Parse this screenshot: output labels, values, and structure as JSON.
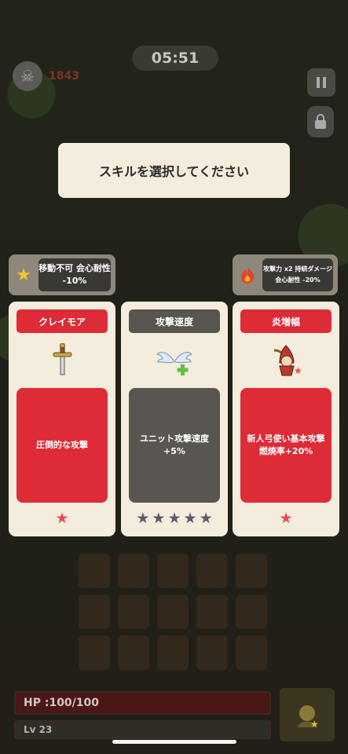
{
  "hud": {
    "timer": "05:51",
    "gold": "1843",
    "pause_icon": "pause-icon",
    "lock_icon": "lock-icon"
  },
  "prompt": {
    "title": "スキルを選択してください"
  },
  "effects": {
    "left": {
      "icon": "star-icon",
      "text": "移動不可 会心耐性 -10%"
    },
    "right": {
      "icon": "fire-icon",
      "text": "攻撃力 x2 持続ダメージ 会心耐性 -20%"
    }
  },
  "cards": [
    {
      "name": "クレイモア",
      "description": "圧倒的な攻撃",
      "icon": "sword-icon",
      "accent": "#dd2b37",
      "stars_total": 1,
      "stars_filled": 1
    },
    {
      "name": "攻撃速度",
      "description": "ユニット攻撃速度+5%",
      "icon": "wing-plus-icon",
      "accent": "#595651",
      "stars_total": 5,
      "stars_filled": 5
    },
    {
      "name": "炎増幅",
      "description": "新人弓使い基本攻撃燃焼率+20%",
      "icon": "archer-icon",
      "accent": "#dd2b37",
      "stars_total": 1,
      "stars_filled": 1
    }
  ],
  "player": {
    "hp": "HP :100/100",
    "level": "Lv 23"
  },
  "colors": {
    "card_bg": "#f4ecdc",
    "red": "#dd2b37",
    "gray": "#595651"
  }
}
